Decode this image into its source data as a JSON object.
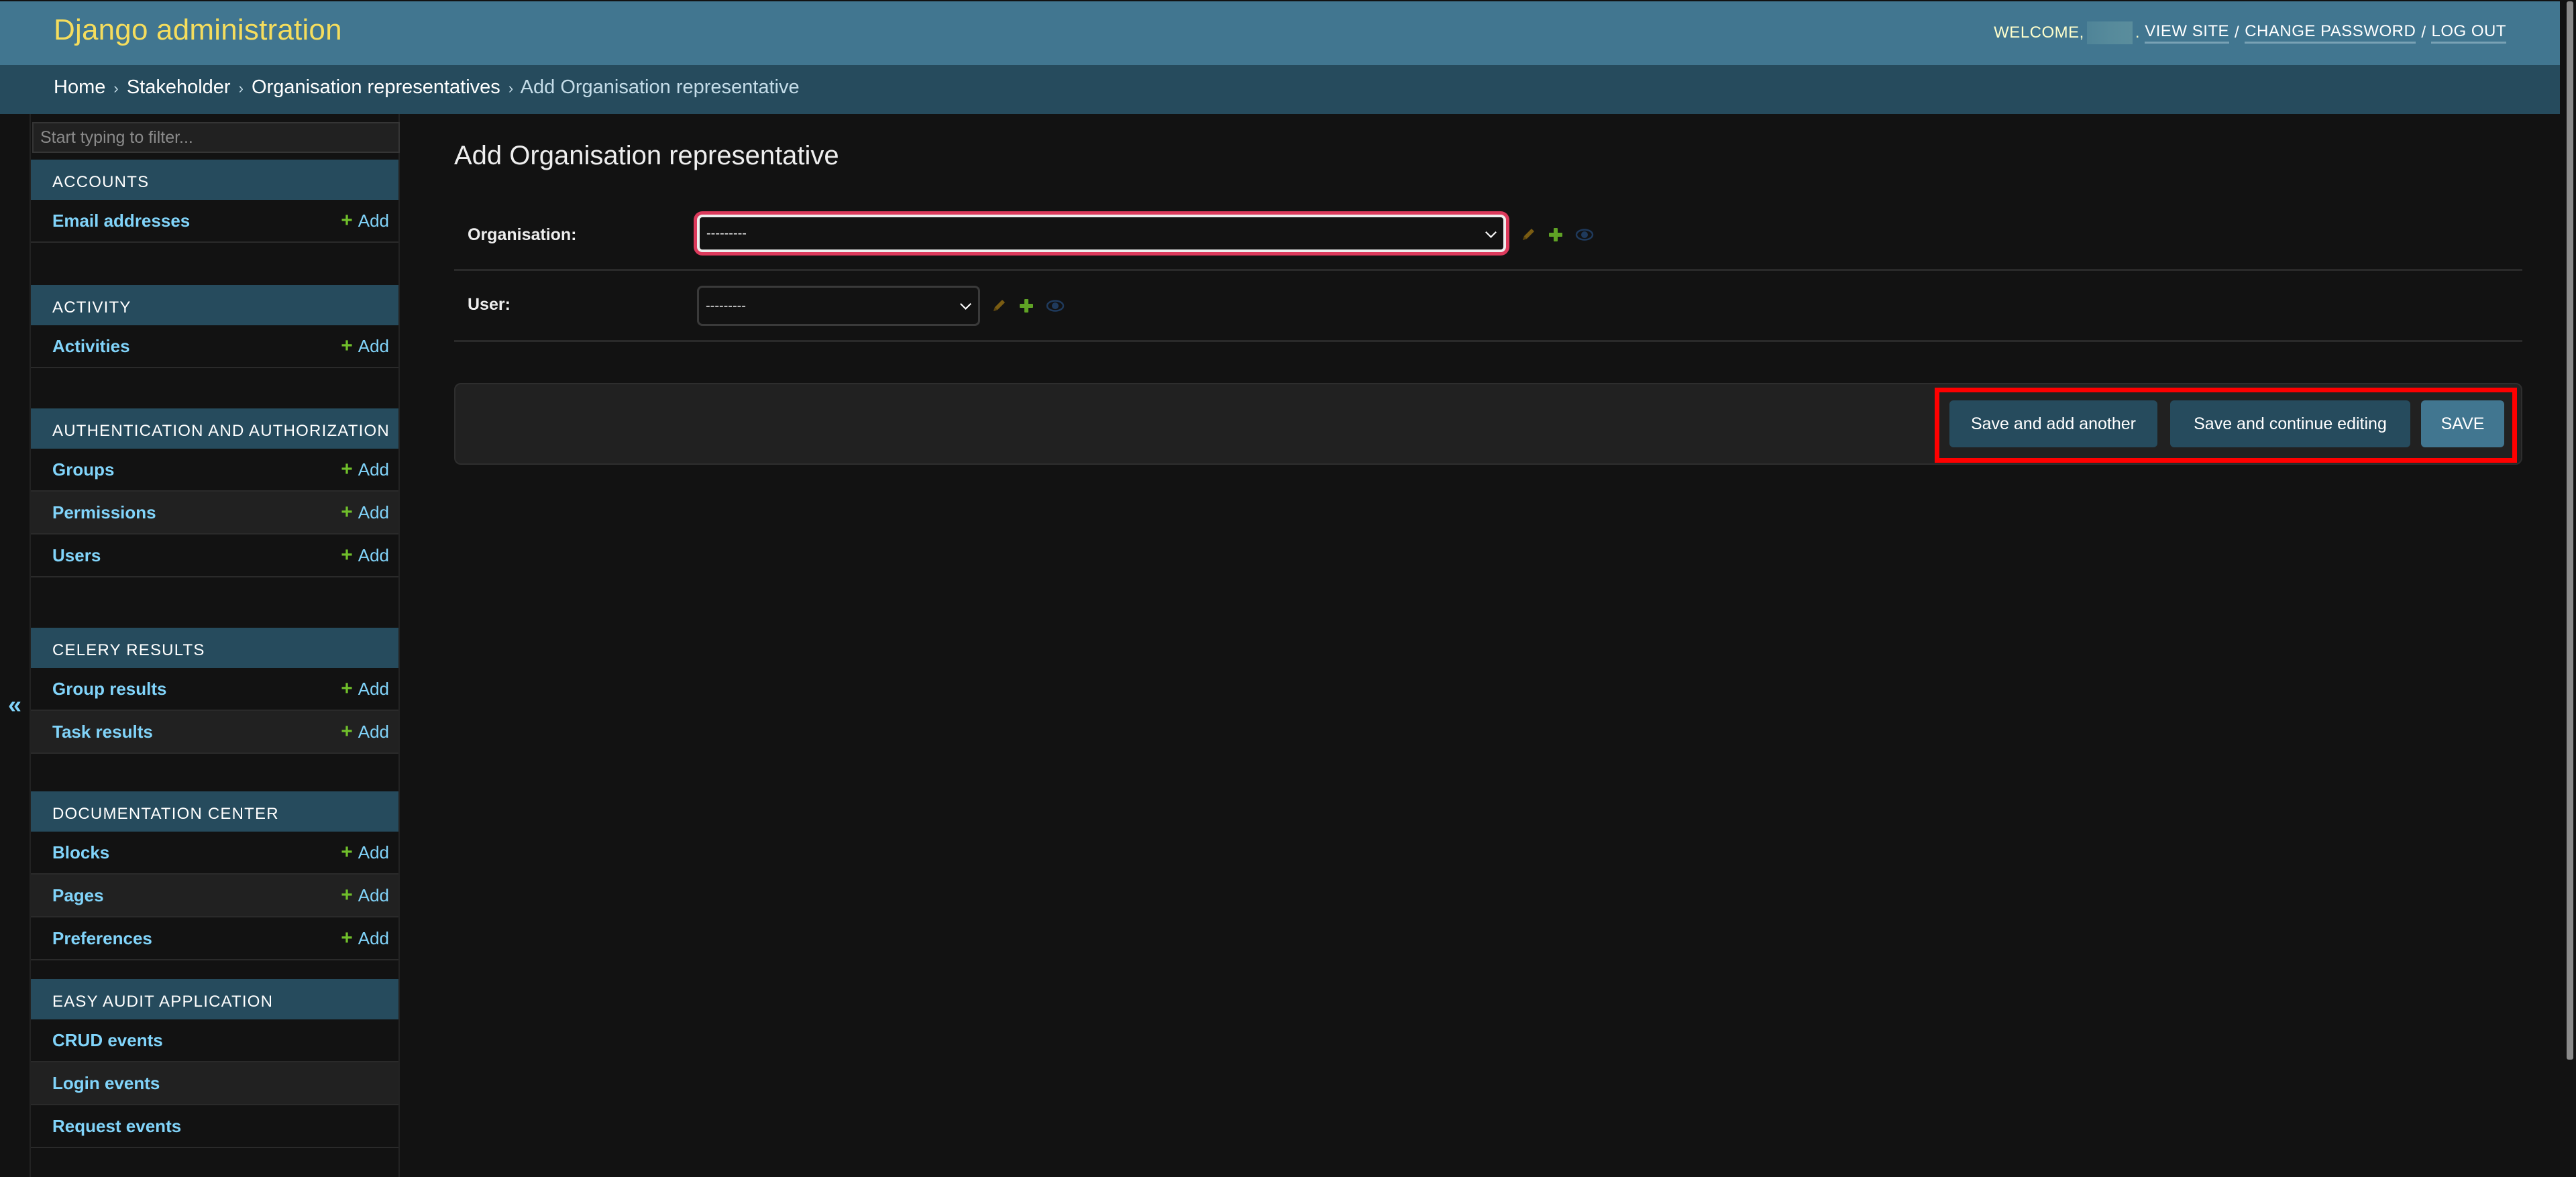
{
  "header": {
    "site_name": "Django administration",
    "welcome_prefix": "WELCOME,",
    "username_redacted": true,
    "user_links": [
      "VIEW SITE",
      "CHANGE PASSWORD",
      "LOG OUT"
    ],
    "link_separator": "/"
  },
  "breadcrumbs": {
    "items": [
      "Home",
      "Stakeholder",
      "Organisation representatives"
    ],
    "current": "Add Organisation representative",
    "separator": "›"
  },
  "sidebar": {
    "filter_placeholder": "Start typing to filter...",
    "toggle_icon": "«",
    "add_label": "Add",
    "modules": [
      {
        "caption": "ACCOUNTS",
        "models": [
          {
            "name": "Email addresses",
            "has_add": true
          }
        ]
      },
      {
        "caption": "ACTIVITY",
        "models": [
          {
            "name": "Activities",
            "has_add": true
          }
        ]
      },
      {
        "caption": "AUTHENTICATION AND AUTHORIZATION",
        "models": [
          {
            "name": "Groups",
            "has_add": true
          },
          {
            "name": "Permissions",
            "has_add": true
          },
          {
            "name": "Users",
            "has_add": true
          }
        ]
      },
      {
        "caption": "CELERY RESULTS",
        "models": [
          {
            "name": "Group results",
            "has_add": true
          },
          {
            "name": "Task results",
            "has_add": true
          }
        ]
      },
      {
        "caption": "DOCUMENTATION CENTER",
        "models": [
          {
            "name": "Blocks",
            "has_add": true
          },
          {
            "name": "Pages",
            "has_add": true
          },
          {
            "name": "Preferences",
            "has_add": true
          }
        ]
      },
      {
        "caption": "EASY AUDIT APPLICATION",
        "models": [
          {
            "name": "CRUD events",
            "has_add": false
          },
          {
            "name": "Login events",
            "has_add": false
          },
          {
            "name": "Request events",
            "has_add": false
          }
        ]
      }
    ]
  },
  "main": {
    "title": "Add Organisation representative",
    "fields": [
      {
        "label": "Organisation:",
        "value": "---------",
        "error": true,
        "icons": [
          "pencil-icon",
          "plus-icon",
          "eye-icon"
        ]
      },
      {
        "label": "User:",
        "value": "---------",
        "error": false,
        "icons": [
          "pencil-icon",
          "plus-icon",
          "eye-icon"
        ]
      }
    ],
    "buttons": {
      "save_add_another": "Save and add another",
      "save_continue": "Save and continue editing",
      "save": "SAVE"
    }
  },
  "colors": {
    "header_bg": "#417690",
    "breadcrumb_bg": "#264b5d",
    "brand_text": "#f5dd5d",
    "link": "#81d4fa",
    "add_plus": "#70bf2b",
    "error_border": "#dc3a5c",
    "highlight": "#ff0000"
  }
}
